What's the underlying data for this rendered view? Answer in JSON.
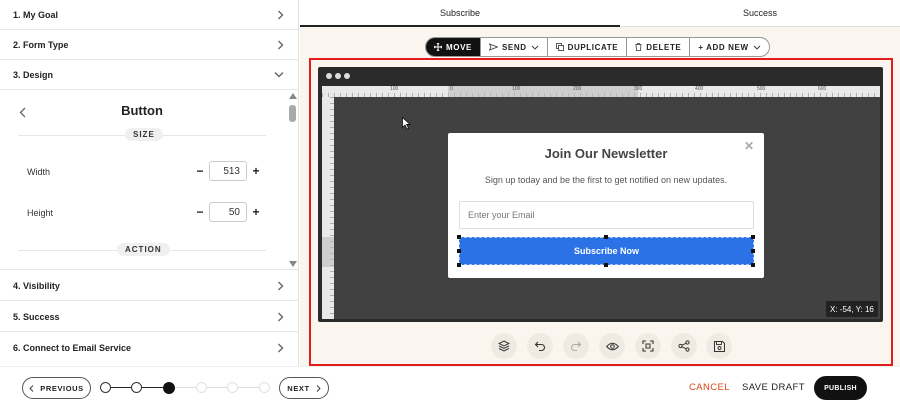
{
  "sidebar": {
    "sections": [
      {
        "label": "1. My Goal"
      },
      {
        "label": "2. Form Type"
      },
      {
        "label": "3. Design"
      },
      {
        "label": "4. Visibility"
      },
      {
        "label": "5. Success"
      },
      {
        "label": "6. Connect to Email Service"
      }
    ],
    "design": {
      "panel_title": "Button",
      "size_label": "SIZE",
      "width_label": "Width",
      "width_value": "513",
      "height_label": "Height",
      "height_value": "50",
      "action_label": "ACTION"
    }
  },
  "tabs": [
    {
      "label": "Subscribe",
      "active": true
    },
    {
      "label": "Success",
      "active": false
    }
  ],
  "toolbar": {
    "move": "MOVE",
    "send": "SEND",
    "duplicate": "DUPLICATE",
    "delete": "DELETE",
    "add_new": "+ ADD NEW"
  },
  "rulers": {
    "top_ticks": [
      "100",
      "0",
      "100",
      "200",
      "300",
      "400",
      "500",
      "600"
    ]
  },
  "popup": {
    "title": "Join Our Newsletter",
    "subtitle": "Sign up today and be the first to get notified on new updates.",
    "email_placeholder": "Enter your Email",
    "button_label": "Subscribe Now",
    "close_glyph": "✕"
  },
  "coords_readout": "X: -54, Y: 16",
  "controls": [
    "layers-icon",
    "undo-icon",
    "redo-icon",
    "preview-icon",
    "fit-screen-icon",
    "share-icon",
    "save-icon"
  ],
  "footer": {
    "previous": "PREVIOUS",
    "next": "NEXT",
    "cancel": "CANCEL",
    "save_draft": "SAVE DRAFT",
    "publish": "PUBLISH",
    "steps_total": 6,
    "current_step": 3
  },
  "colors": {
    "accent_blue": "#2a72e5",
    "cancel_red": "#d9461a",
    "frame_red": "#e41c1c",
    "canvas_bg": "#414141"
  }
}
